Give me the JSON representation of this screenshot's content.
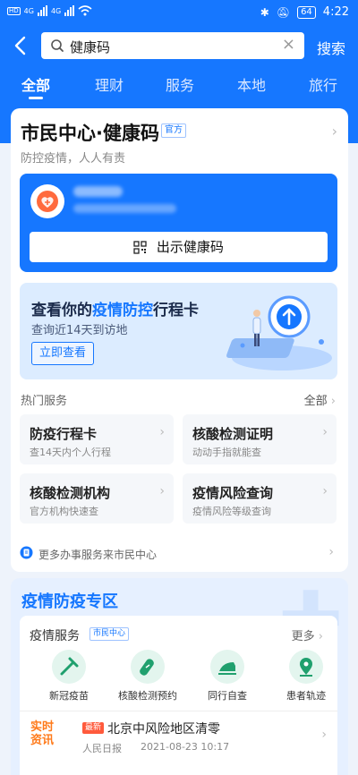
{
  "status_bar": {
    "hd_badge": "HD",
    "network": "4G",
    "battery": "64",
    "time": "4:22"
  },
  "search": {
    "query": "健康码",
    "button": "搜索"
  },
  "tabs": [
    "全部",
    "理财",
    "服务",
    "本地",
    "旅行"
  ],
  "citizen_center": {
    "title": "市民中心·健康码",
    "badge": "官方",
    "subtitle": "防控疫情，人人有责",
    "show_code_button": "出示健康码",
    "banner": {
      "title_prefix": "查看你的",
      "title_highlight": "疫情防控",
      "title_suffix": "行程卡",
      "subtitle": "查询近14天到访地",
      "button": "立即查看"
    },
    "hot_services_label": "热门服务",
    "hot_services_all": "全部",
    "services": [
      {
        "title": "防疫行程卡",
        "desc": "查14天内个人行程"
      },
      {
        "title": "核酸检测证明",
        "desc": "动动手指就能查"
      },
      {
        "title": "核酸检测机构",
        "desc": "官方机构快速查"
      },
      {
        "title": "疫情风险查询",
        "desc": "疫情风险等级查询"
      }
    ],
    "more_services": "更多办事服务来市民中心"
  },
  "epidemic_zone": {
    "title": "疫情防疫专区",
    "services_title": "疫情服务",
    "services_badge": "市民中心",
    "more": "更多",
    "icons": [
      {
        "label": "新冠疫苗",
        "icon": "vaccine-icon"
      },
      {
        "label": "核酸检测预约",
        "icon": "test-tube-icon"
      },
      {
        "label": "同行自查",
        "icon": "train-icon"
      },
      {
        "label": "患者轨迹",
        "icon": "location-icon"
      }
    ],
    "news": {
      "logo_line1": "实时",
      "logo_line2": "资讯",
      "tag": "最新",
      "headline": "北京中风险地区清零",
      "source": "人民日报",
      "time": "2021-08-23 10:17"
    }
  },
  "colors": {
    "brand": "#1677ff",
    "orange": "#ff7a1a",
    "green": "#20a06e"
  }
}
